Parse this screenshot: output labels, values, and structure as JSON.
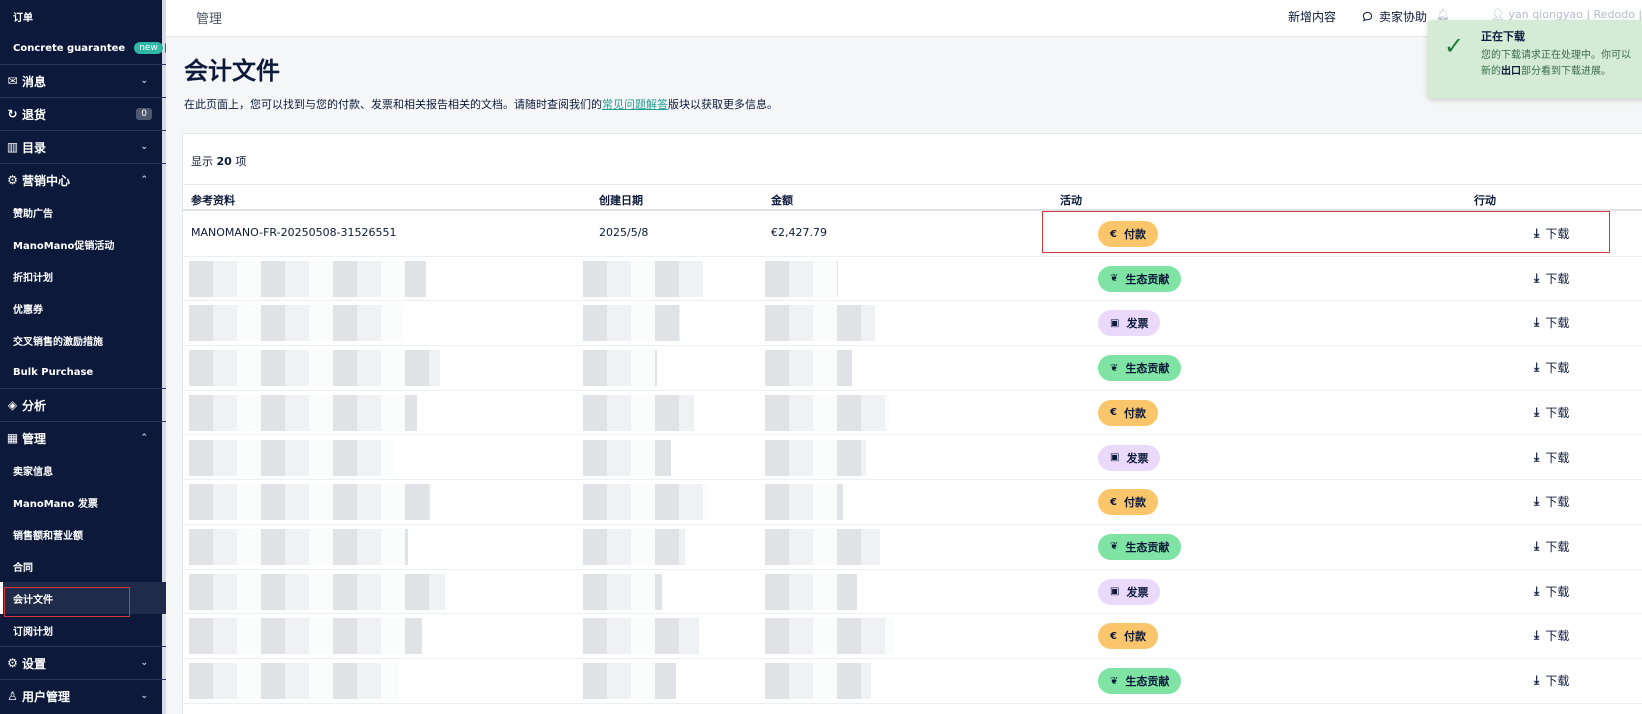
{
  "sidebar": {
    "items": [
      {
        "type": "sub",
        "label": "订单"
      },
      {
        "type": "sub",
        "label": "Concrete guarantee",
        "badge_new": "new",
        "badge_count": "0"
      },
      {
        "type": "section",
        "label": "消息",
        "icon": "mail-icon",
        "chevron": "down"
      },
      {
        "type": "section",
        "label": "退货",
        "icon": "refresh-icon",
        "badge_count": "0"
      },
      {
        "type": "section",
        "label": "目录",
        "icon": "book-icon",
        "chevron": "down"
      },
      {
        "type": "section",
        "label": "营销中心",
        "icon": "gear-icon",
        "chevron": "up"
      },
      {
        "type": "sub",
        "label": "赞助广告"
      },
      {
        "type": "sub",
        "label": "ManoMano促销活动"
      },
      {
        "type": "sub",
        "label": "折扣计划"
      },
      {
        "type": "sub",
        "label": "优惠券"
      },
      {
        "type": "sub",
        "label": "交叉销售的激励措施"
      },
      {
        "type": "sub",
        "label": "Bulk Purchase"
      },
      {
        "type": "section",
        "label": "分析",
        "icon": "analytics-icon"
      },
      {
        "type": "section",
        "label": "管理",
        "icon": "building-icon",
        "chevron": "up"
      },
      {
        "type": "sub",
        "label": "卖家信息"
      },
      {
        "type": "sub",
        "label": "ManoMano 发票"
      },
      {
        "type": "sub",
        "label": "销售额和营业额"
      },
      {
        "type": "sub",
        "label": "合同"
      },
      {
        "type": "sub",
        "label": "会计文件",
        "active": true
      },
      {
        "type": "sub",
        "label": "订阅计划"
      },
      {
        "type": "section",
        "label": "设置",
        "icon": "gear-icon",
        "chevron": "down"
      },
      {
        "type": "section",
        "label": "用户管理",
        "icon": "user-icon",
        "chevron": "down"
      }
    ]
  },
  "topbar": {
    "breadcrumb": "管理",
    "new_content": "新增内容",
    "seller_help": "卖家协助",
    "user": "yan qiongyao | Redodo | C"
  },
  "page": {
    "title": "会计文件",
    "intro_before": "在此页面上，您可以找到与您的付款、发票和相关报告相关的文档。请随时查阅我们的",
    "intro_link": "常见问题解答",
    "intro_after": "版块以获取更多信息。"
  },
  "table": {
    "count_prefix": "显示",
    "count_value": "20",
    "count_suffix": "项",
    "columns": {
      "ref": "参考资料",
      "date": "创建日期",
      "amount": "金额",
      "activity": "活动",
      "action": "行动"
    },
    "download_label": "下载",
    "first_row": {
      "ref": "MANOMANO-FR-20250508-31526551",
      "date": "2025/5/8",
      "amount": "€2,427.79"
    },
    "activities": [
      {
        "label": "付款",
        "kind": "payment",
        "icon": "€"
      },
      {
        "label": "生态贡献",
        "kind": "eco",
        "icon": "leaf-icon"
      },
      {
        "label": "发票",
        "kind": "invoice",
        "icon": "invoice-icon"
      },
      {
        "label": "生态贡献",
        "kind": "eco",
        "icon": "leaf-icon"
      },
      {
        "label": "付款",
        "kind": "payment",
        "icon": "€"
      },
      {
        "label": "发票",
        "kind": "invoice",
        "icon": "invoice-icon"
      },
      {
        "label": "付款",
        "kind": "payment",
        "icon": "€"
      },
      {
        "label": "生态贡献",
        "kind": "eco",
        "icon": "leaf-icon"
      },
      {
        "label": "发票",
        "kind": "invoice",
        "icon": "invoice-icon"
      },
      {
        "label": "付款",
        "kind": "payment",
        "icon": "€"
      },
      {
        "label": "生态贡献",
        "kind": "eco",
        "icon": "leaf-icon"
      }
    ]
  },
  "toast": {
    "title": "正在下载",
    "body_line1": "您的下载请求正在处理中。你可以",
    "body_line2_before": "新的",
    "body_line2_bold": "出口",
    "body_line2_after": "部分看到下载进展。"
  },
  "colors": {
    "sidebar_bg": "#0c193a",
    "accent_teal": "#2fb8a6",
    "payment_pill": "#fbc66b",
    "eco_pill": "#7ee3a3",
    "invoice_pill": "#ead9fb",
    "highlight": "#d6363a"
  }
}
